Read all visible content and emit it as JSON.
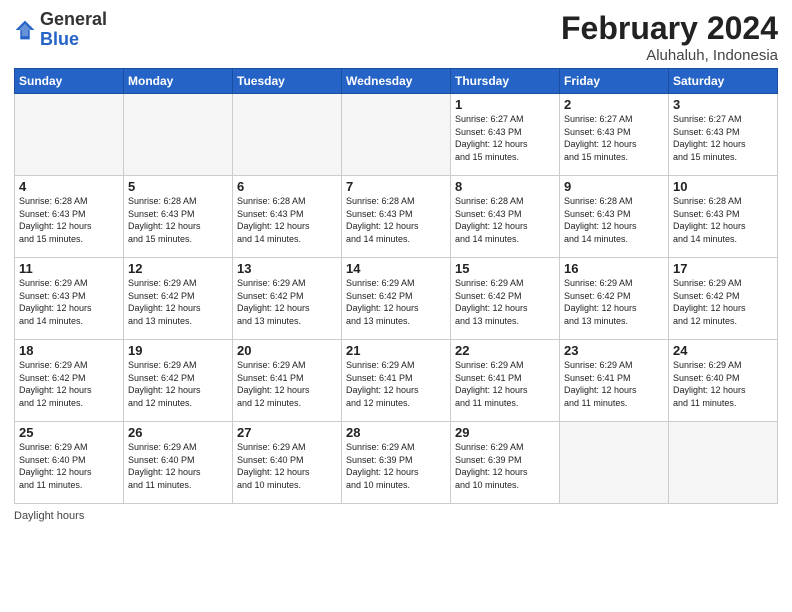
{
  "logo": {
    "general": "General",
    "blue": "Blue"
  },
  "header": {
    "month_year": "February 2024",
    "location": "Aluhaluh, Indonesia"
  },
  "days_of_week": [
    "Sunday",
    "Monday",
    "Tuesday",
    "Wednesday",
    "Thursday",
    "Friday",
    "Saturday"
  ],
  "weeks": [
    [
      {
        "day": "",
        "info": "",
        "empty": true
      },
      {
        "day": "",
        "info": "",
        "empty": true
      },
      {
        "day": "",
        "info": "",
        "empty": true
      },
      {
        "day": "",
        "info": "",
        "empty": true
      },
      {
        "day": "1",
        "info": "Sunrise: 6:27 AM\nSunset: 6:43 PM\nDaylight: 12 hours\nand 15 minutes."
      },
      {
        "day": "2",
        "info": "Sunrise: 6:27 AM\nSunset: 6:43 PM\nDaylight: 12 hours\nand 15 minutes."
      },
      {
        "day": "3",
        "info": "Sunrise: 6:27 AM\nSunset: 6:43 PM\nDaylight: 12 hours\nand 15 minutes."
      }
    ],
    [
      {
        "day": "4",
        "info": "Sunrise: 6:28 AM\nSunset: 6:43 PM\nDaylight: 12 hours\nand 15 minutes."
      },
      {
        "day": "5",
        "info": "Sunrise: 6:28 AM\nSunset: 6:43 PM\nDaylight: 12 hours\nand 15 minutes."
      },
      {
        "day": "6",
        "info": "Sunrise: 6:28 AM\nSunset: 6:43 PM\nDaylight: 12 hours\nand 14 minutes."
      },
      {
        "day": "7",
        "info": "Sunrise: 6:28 AM\nSunset: 6:43 PM\nDaylight: 12 hours\nand 14 minutes."
      },
      {
        "day": "8",
        "info": "Sunrise: 6:28 AM\nSunset: 6:43 PM\nDaylight: 12 hours\nand 14 minutes."
      },
      {
        "day": "9",
        "info": "Sunrise: 6:28 AM\nSunset: 6:43 PM\nDaylight: 12 hours\nand 14 minutes."
      },
      {
        "day": "10",
        "info": "Sunrise: 6:28 AM\nSunset: 6:43 PM\nDaylight: 12 hours\nand 14 minutes."
      }
    ],
    [
      {
        "day": "11",
        "info": "Sunrise: 6:29 AM\nSunset: 6:43 PM\nDaylight: 12 hours\nand 14 minutes."
      },
      {
        "day": "12",
        "info": "Sunrise: 6:29 AM\nSunset: 6:42 PM\nDaylight: 12 hours\nand 13 minutes."
      },
      {
        "day": "13",
        "info": "Sunrise: 6:29 AM\nSunset: 6:42 PM\nDaylight: 12 hours\nand 13 minutes."
      },
      {
        "day": "14",
        "info": "Sunrise: 6:29 AM\nSunset: 6:42 PM\nDaylight: 12 hours\nand 13 minutes."
      },
      {
        "day": "15",
        "info": "Sunrise: 6:29 AM\nSunset: 6:42 PM\nDaylight: 12 hours\nand 13 minutes."
      },
      {
        "day": "16",
        "info": "Sunrise: 6:29 AM\nSunset: 6:42 PM\nDaylight: 12 hours\nand 13 minutes."
      },
      {
        "day": "17",
        "info": "Sunrise: 6:29 AM\nSunset: 6:42 PM\nDaylight: 12 hours\nand 12 minutes."
      }
    ],
    [
      {
        "day": "18",
        "info": "Sunrise: 6:29 AM\nSunset: 6:42 PM\nDaylight: 12 hours\nand 12 minutes."
      },
      {
        "day": "19",
        "info": "Sunrise: 6:29 AM\nSunset: 6:42 PM\nDaylight: 12 hours\nand 12 minutes."
      },
      {
        "day": "20",
        "info": "Sunrise: 6:29 AM\nSunset: 6:41 PM\nDaylight: 12 hours\nand 12 minutes."
      },
      {
        "day": "21",
        "info": "Sunrise: 6:29 AM\nSunset: 6:41 PM\nDaylight: 12 hours\nand 12 minutes."
      },
      {
        "day": "22",
        "info": "Sunrise: 6:29 AM\nSunset: 6:41 PM\nDaylight: 12 hours\nand 11 minutes."
      },
      {
        "day": "23",
        "info": "Sunrise: 6:29 AM\nSunset: 6:41 PM\nDaylight: 12 hours\nand 11 minutes."
      },
      {
        "day": "24",
        "info": "Sunrise: 6:29 AM\nSunset: 6:40 PM\nDaylight: 12 hours\nand 11 minutes."
      }
    ],
    [
      {
        "day": "25",
        "info": "Sunrise: 6:29 AM\nSunset: 6:40 PM\nDaylight: 12 hours\nand 11 minutes."
      },
      {
        "day": "26",
        "info": "Sunrise: 6:29 AM\nSunset: 6:40 PM\nDaylight: 12 hours\nand 11 minutes."
      },
      {
        "day": "27",
        "info": "Sunrise: 6:29 AM\nSunset: 6:40 PM\nDaylight: 12 hours\nand 10 minutes."
      },
      {
        "day": "28",
        "info": "Sunrise: 6:29 AM\nSunset: 6:39 PM\nDaylight: 12 hours\nand 10 minutes."
      },
      {
        "day": "29",
        "info": "Sunrise: 6:29 AM\nSunset: 6:39 PM\nDaylight: 12 hours\nand 10 minutes."
      },
      {
        "day": "",
        "info": "",
        "empty": true
      },
      {
        "day": "",
        "info": "",
        "empty": true
      }
    ]
  ],
  "footer": {
    "label": "Daylight hours"
  }
}
